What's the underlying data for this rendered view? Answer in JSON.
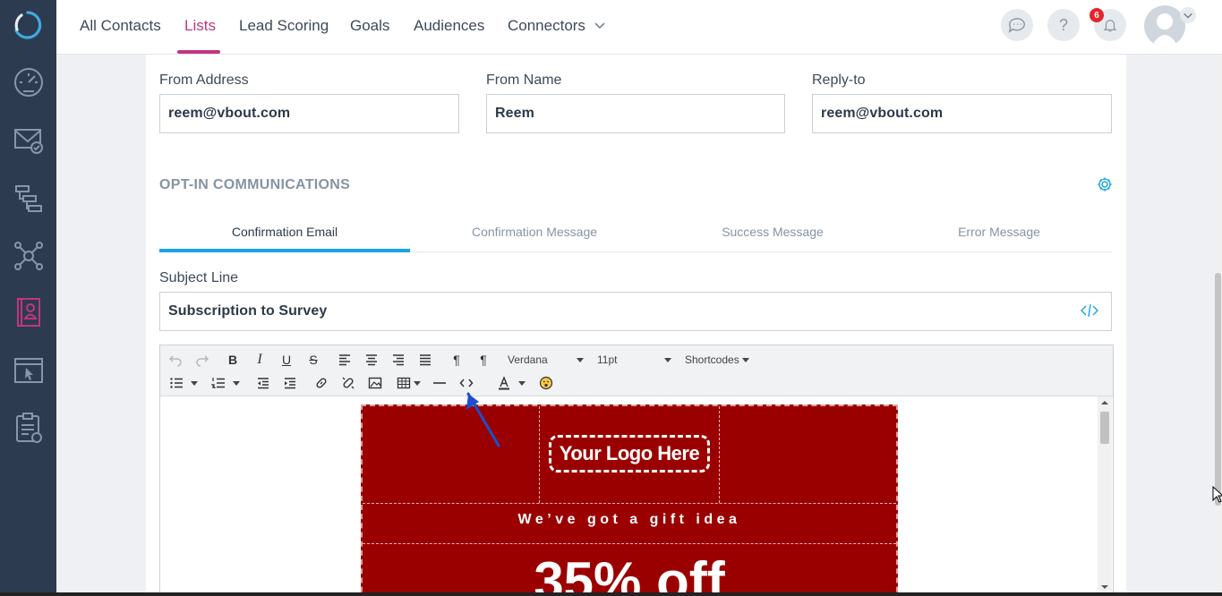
{
  "nav": {
    "tabs": [
      {
        "label": "All Contacts"
      },
      {
        "label": "Lists"
      },
      {
        "label": "Lead Scoring"
      },
      {
        "label": "Goals"
      },
      {
        "label": "Audiences"
      },
      {
        "label": "Connectors"
      }
    ],
    "active_tab": "Lists",
    "notification_count": "6",
    "help_label": "?"
  },
  "sidebar": {
    "items": [
      {
        "icon": "speedometer-icon"
      },
      {
        "icon": "email-check-icon"
      },
      {
        "icon": "workflow-icon"
      },
      {
        "icon": "network-icon"
      },
      {
        "icon": "contacts-icon"
      },
      {
        "icon": "screen-cursor-icon"
      },
      {
        "icon": "clipboard-check-icon"
      }
    ],
    "active_item": "contacts-icon"
  },
  "form": {
    "from_address_label": "From Address",
    "from_address_value": "reem@vbout.com",
    "from_name_label": "From Name",
    "from_name_value": "Reem",
    "reply_to_label": "Reply-to",
    "reply_to_value": "reem@vbout.com"
  },
  "optin": {
    "title": "OPT-IN COMMUNICATIONS",
    "tabs": [
      {
        "label": "Confirmation Email"
      },
      {
        "label": "Confirmation Message"
      },
      {
        "label": "Success Message"
      },
      {
        "label": "Error Message"
      }
    ],
    "active_tab": "Confirmation Email",
    "subject_label": "Subject Line",
    "subject_value": "Subscription to Survey"
  },
  "editor": {
    "font_family": "Verdana",
    "font_size": "11pt",
    "shortcodes_label": "Shortcodes"
  },
  "email_preview": {
    "logo_text": "Your Logo Here",
    "tagline": "We’ve got a gift idea",
    "headline": "35% off",
    "background_color": "#9b0000"
  },
  "colors": {
    "accent": "#c2357f",
    "tab_active": "#1aa3e6",
    "sidebar_bg": "#2c3b4f"
  }
}
